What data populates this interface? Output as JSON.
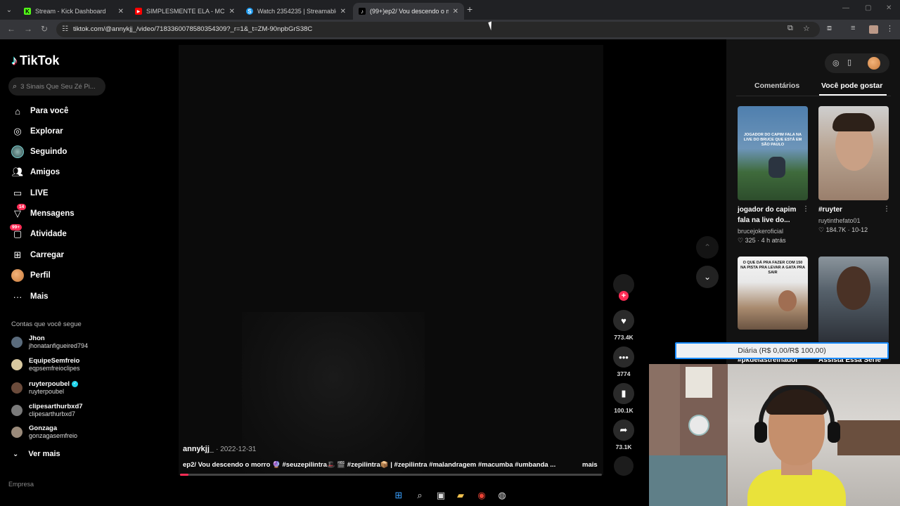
{
  "browser": {
    "tabs": [
      {
        "title": "Stream - Kick Dashboard",
        "favicon": "kick-icon",
        "color": "#53fc18",
        "letter": "K"
      },
      {
        "title": "SIMPLESMENTE ELA - MC GAB",
        "favicon": "youtube-icon",
        "color": "#ff0000",
        "letter": "▶"
      },
      {
        "title": "Watch 2354235 | Streamable",
        "favicon": "streamable-icon",
        "color": "#1d9bf0",
        "letter": "S"
      },
      {
        "title": "(99+)ep2/ Vou descendo o mo",
        "favicon": "tiktok-icon",
        "color": "#000000",
        "letter": "♪"
      }
    ],
    "active_tab": 3,
    "url": "tiktok.com/@annykjj_/video/7183360078580354309?_r=1&_t=ZM-90npbGrS38C"
  },
  "sidebar": {
    "logo_text": "TikTok",
    "search_placeholder": "3 Sinais Que Seu Zé Pi...",
    "nav": [
      {
        "label": "Para você",
        "icon": "home-icon"
      },
      {
        "label": "Explorar",
        "icon": "compass-icon"
      },
      {
        "label": "Seguindo",
        "icon": "following-avatar-icon"
      },
      {
        "label": "Amigos",
        "icon": "friends-icon"
      },
      {
        "label": "LIVE",
        "icon": "live-icon"
      },
      {
        "label": "Mensagens",
        "icon": "messages-icon",
        "badge": "14"
      },
      {
        "label": "Atividade",
        "icon": "activity-icon",
        "badge": "99+"
      },
      {
        "label": "Carregar",
        "icon": "upload-icon"
      },
      {
        "label": "Perfil",
        "icon": "profile-avatar-icon"
      },
      {
        "label": "Mais",
        "icon": "more-icon"
      }
    ],
    "following_title": "Contas que você segue",
    "following": [
      {
        "name": "Jhon",
        "handle": "jhonatanfigueired794",
        "color": "#5a6b7c"
      },
      {
        "name": "EquipeSemfreio",
        "handle": "eqpsemfreioclipes",
        "color": "#d9c9a0"
      },
      {
        "name": "ruyterpoubel",
        "handle": "ruyterpoubel",
        "color": "#6b4b3b",
        "verified": true
      },
      {
        "name": "clipesarthurbxd7",
        "handle": "clipesarthurbxd7",
        "color": "#7a7a7a"
      },
      {
        "name": "Gonzaga",
        "handle": "gonzagasemfreio",
        "color": "#9a8a7a"
      }
    ],
    "see_more": "Ver mais",
    "footer_cut": "Empresa"
  },
  "video": {
    "author": "annykjj_",
    "date": "2022-12-31",
    "caption": "ep2/ Vou descendo o morro 🔮 #seuzepilintra🎩 🎬 #zepilintra📦 | #zepilintra #malandragem #macumba #umbanda ...",
    "more_label": "mais",
    "progress": 0.02,
    "actions": {
      "likes": "773.4K",
      "comments": "3774",
      "saves": "100.1K",
      "shares": "73.1K"
    }
  },
  "right_panel": {
    "tabs": [
      "Comentários",
      "Você pode gostar"
    ],
    "active_tab": 1,
    "cards": [
      {
        "title_line1": "jogador do capim",
        "title_line2": "fala na live do...",
        "user": "brucejokeroficial",
        "likes": "325",
        "time": "4 h atrás",
        "overlay": "JOGADOR DO CAPIM FALA NA LIVE DO BRUCE QUE ESTÁ EM SÃO PAULO"
      },
      {
        "title_line1": "#ruyter",
        "user": "ruytinthefato01",
        "likes": "184.7K",
        "time": "10-12"
      },
      {
        "title_line1": "#pkdelastreinador",
        "overlay": "O QUE DÁ PRA FAZER COM 150 NA PISTA PRA LEVAR A GATA PRA SAIR"
      },
      {
        "title_line1": "Assista Essa Série"
      }
    ]
  },
  "overlay": {
    "donation_goal": "Diária (R$ 0,00/R$ 100,00)"
  }
}
